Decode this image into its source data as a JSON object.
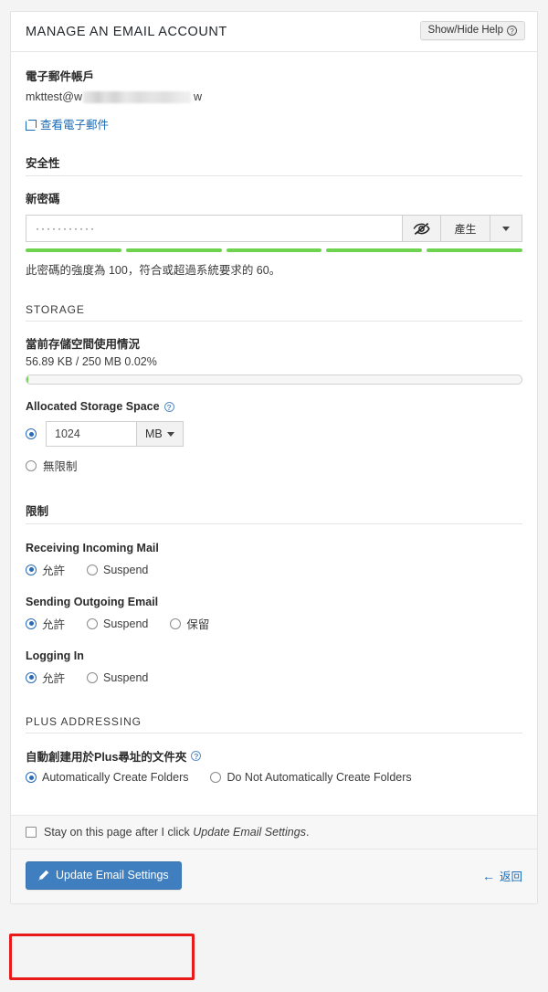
{
  "header": {
    "title": "MANAGE AN EMAIL ACCOUNT",
    "help_toggle_label": "Show/Hide Help",
    "help_icon": "question-circle-icon"
  },
  "account": {
    "label": "電子郵件帳戶",
    "email_prefix": "mkttest@w",
    "email_suffix": "w",
    "view_email_link": "查看電子郵件",
    "external_icon": "external-link-icon"
  },
  "security": {
    "section_title": "安全性",
    "password_label": "新密碼",
    "password_value": "···········",
    "password_masked_chars": 11,
    "toggle_visibility_icon": "eye-slash-icon",
    "generate_label": "產生",
    "dropdown_icon": "caret-down-icon",
    "strength_segments": 5,
    "strength_color": "#6ed450",
    "strength_note": "此密碼的強度為 100，符合或超過系統要求的 60。",
    "strength_value": 100,
    "strength_required": 60
  },
  "storage": {
    "section_title": "STORAGE",
    "usage_label": "當前存儲空間使用情況",
    "usage_text": "56.89 KB / 250 MB 0.02%",
    "usage_percent": 0.02,
    "allocated_label": "Allocated Storage Space",
    "allocated_help_icon": "question-circle-icon",
    "allocated_value": "1024",
    "allocated_unit": "MB",
    "unit_caret_icon": "caret-down-icon",
    "unlimited_label": "無限制",
    "allocated_selected": true,
    "unlimited_selected": false
  },
  "restrictions": {
    "section_title": "限制",
    "groups": [
      {
        "label": "Receiving Incoming Mail",
        "options": [
          {
            "label": "允許",
            "selected": true
          },
          {
            "label": "Suspend",
            "selected": false
          }
        ]
      },
      {
        "label": "Sending Outgoing Email",
        "options": [
          {
            "label": "允許",
            "selected": true
          },
          {
            "label": "Suspend",
            "selected": false
          },
          {
            "label": "保留",
            "selected": false
          }
        ]
      },
      {
        "label": "Logging In",
        "options": [
          {
            "label": "允許",
            "selected": true
          },
          {
            "label": "Suspend",
            "selected": false
          }
        ]
      }
    ]
  },
  "plus_addressing": {
    "section_title": "PLUS ADDRESSING",
    "label": "自動創建用於Plus尋址的文件夾",
    "help_icon": "question-circle-icon",
    "options": [
      {
        "label": "Automatically Create Folders",
        "selected": true
      },
      {
        "label": "Do Not Automatically Create Folders",
        "selected": false
      }
    ]
  },
  "footer": {
    "stay_checkbox_checked": false,
    "stay_text_before": "Stay on this page after I click ",
    "stay_text_italic": "Update Email Settings",
    "stay_text_after": ".",
    "submit_label": "Update Email Settings",
    "submit_icon": "pencil-icon",
    "submit_color": "#3f7fbf",
    "back_label": "返回",
    "back_icon": "arrow-left-icon",
    "highlight_color": "#e81a1a"
  }
}
